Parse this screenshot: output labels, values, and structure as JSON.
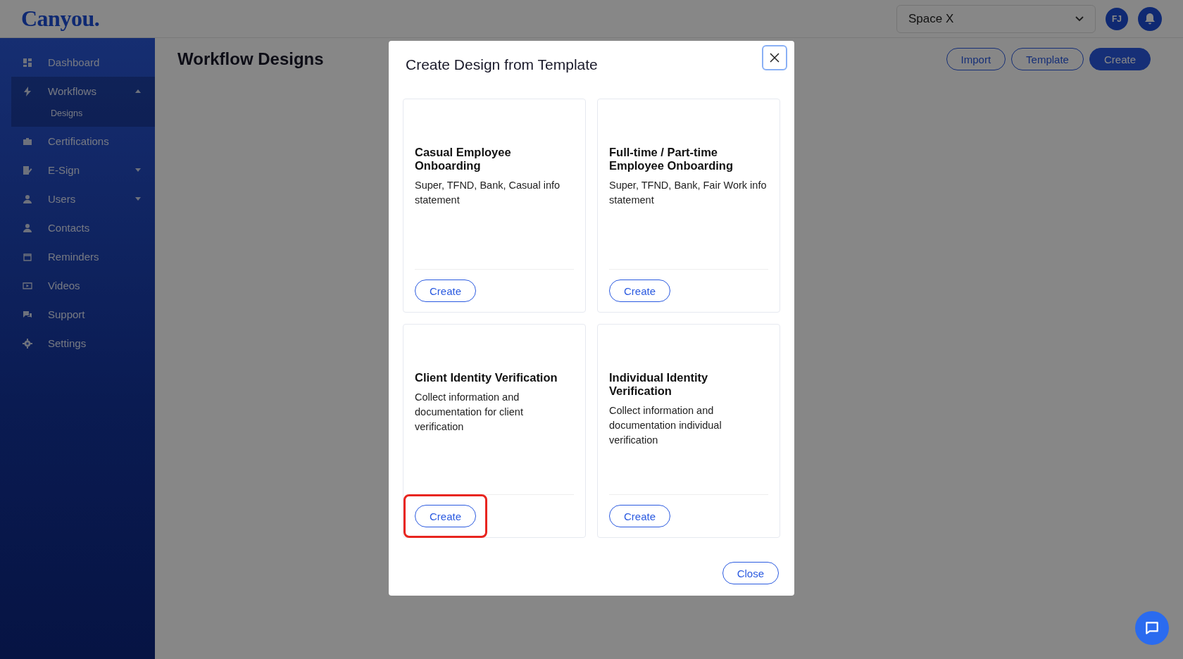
{
  "header": {
    "logo": "Canyou.",
    "space_select": {
      "value": "Space X"
    },
    "avatar": "FJ"
  },
  "sidebar": {
    "items": [
      {
        "label": "Dashboard",
        "kind": "link",
        "selected": false
      },
      {
        "label": "Workflows",
        "kind": "group",
        "expanded": true,
        "selected": true,
        "children": [
          {
            "label": "Designs",
            "selected": true
          }
        ]
      },
      {
        "label": "Certifications",
        "kind": "link",
        "selected": false
      },
      {
        "label": "E-Sign",
        "kind": "group",
        "expanded": false,
        "selected": false
      },
      {
        "label": "Users",
        "kind": "group",
        "expanded": false,
        "selected": false
      },
      {
        "label": "Contacts",
        "kind": "link",
        "selected": false
      },
      {
        "label": "Reminders",
        "kind": "link",
        "selected": false
      },
      {
        "label": "Videos",
        "kind": "link",
        "selected": false
      },
      {
        "label": "Support",
        "kind": "link",
        "selected": false
      },
      {
        "label": "Settings",
        "kind": "link",
        "selected": false
      }
    ]
  },
  "page": {
    "title": "Workflow Designs",
    "actions": [
      {
        "label": "Import",
        "kind": "outline"
      },
      {
        "label": "Template",
        "kind": "outline"
      },
      {
        "label": "Create",
        "kind": "primary"
      }
    ]
  },
  "dialog": {
    "title": "Create Design from Template",
    "templates": [
      {
        "title": "Casual Employee Onboarding",
        "description": "Super, TFND, Bank, Casual info statement",
        "button": "Create",
        "highlighted": false
      },
      {
        "title": "Full-time / Part-time Employee Onboarding",
        "description": "Super, TFND, Bank, Fair Work info statement",
        "button": "Create",
        "highlighted": false
      },
      {
        "title": "Client Identity Verification",
        "description": "Collect information and documentation for client verification",
        "button": "Create",
        "highlighted": true
      },
      {
        "title": "Individual Identity Verification",
        "description": "Collect information and documentation individual verification",
        "button": "Create",
        "highlighted": false
      }
    ],
    "close_button": "Close"
  }
}
